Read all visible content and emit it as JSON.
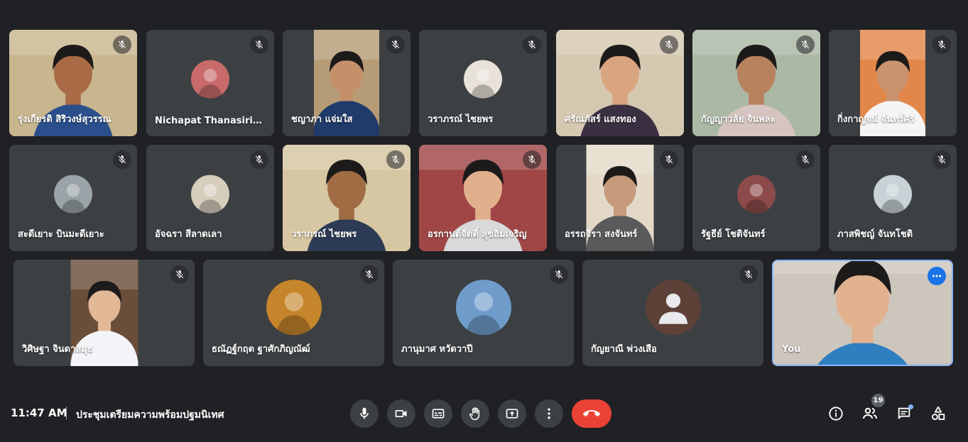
{
  "participants": [
    {
      "name": "รุ่งเกียรติ สิริวงษ์สุวรรณ",
      "video": "camera",
      "bg": "#c8b68f",
      "skin": "#a86b45",
      "shirt": "#2a4f8c"
    },
    {
      "name": "Nichapat Thanasiriyur...",
      "video": "avatar",
      "bg": "#c96b6b"
    },
    {
      "name": "ชญาภา แจ่มใส",
      "video": "camera",
      "bg": "#b59b76",
      "skin": "#c58f6a",
      "shirt": "#203a6a"
    },
    {
      "name": "วราภรณ์ ไชยพร",
      "video": "avatar",
      "bg": "#e8e2da"
    },
    {
      "name": "ศรัณภัสร์ แสงทอง",
      "video": "camera",
      "bg": "#d5c8b0",
      "skin": "#d9a57e",
      "shirt": "#3b3042"
    },
    {
      "name": "กัญญาวลัย จินพละ",
      "video": "camera",
      "bg": "#aab8a4",
      "skin": "#b9825e",
      "shirt": "#d6c4c0"
    },
    {
      "name": "กิ่งกาญจน์ จันทร์ศิริ",
      "video": "camera",
      "bg": "#e2874a",
      "skin": "#c9936e",
      "shirt": "#f4f4f4"
    },
    {
      "name": "สะดีเยาะ บินมะดีเยาะ",
      "video": "avatar",
      "bg": "#9aa3a8"
    },
    {
      "name": "อัจฉรา สีลาดเลา",
      "video": "avatar",
      "bg": "#d7cdbd"
    },
    {
      "name": "วราภรณ์ ไชยพร",
      "video": "camera",
      "bg": "#d6c6a2",
      "skin": "#a06c44",
      "shirt": "#2d3b56"
    },
    {
      "name": "อรกานต์จิตติ์ สุขอิ่มเจริญ",
      "video": "camera",
      "bg": "#a04646",
      "skin": "#e0b08c",
      "shirt": "#d9d9d9"
    },
    {
      "name": "อรรถจิรา สงจันทร์",
      "video": "camera",
      "bg": "#e4d9c9",
      "skin": "#c79a7c",
      "shirt": "#5a5a5a"
    },
    {
      "name": "รัฐธีย์ โชติจันทร์",
      "video": "avatar",
      "bg": "#8c4a4a"
    },
    {
      "name": "ภาสพิชญ์ จันทโชติ",
      "video": "avatar",
      "bg": "#c7d1d6"
    },
    {
      "name": "วิศิษฐา จินดาสมุธ",
      "video": "camera",
      "bg": "#6b4e3a",
      "skin": "#e2b897",
      "shirt": "#f2f4f7"
    },
    {
      "name": "ธณัฏฐ์กฤต ฐาศักภิญณัฒ์",
      "video": "avatar",
      "bg": "#c5852a"
    },
    {
      "name": "ภานุมาศ หวัดวาปี",
      "video": "avatar",
      "bg": "#6f9ccb"
    },
    {
      "name": "กัญยาณี พ่วงเสือ",
      "video": "initials",
      "bg": "#5d4037"
    },
    {
      "name": "You",
      "video": "camera",
      "bg": "#cdc6bd",
      "skin": "#e2b18e",
      "shirt": "#2f7fc0"
    }
  ],
  "bottom_bar": {
    "time": "11:47 AM",
    "meeting_title": "ประชุมเตรียมความพร้อมปฐมนิเทศ",
    "participant_count": "19"
  },
  "colors": {
    "accent": "#8ab4f8",
    "end_call": "#ea4335",
    "tile_bg": "#3c4043",
    "page_bg": "#202124"
  }
}
